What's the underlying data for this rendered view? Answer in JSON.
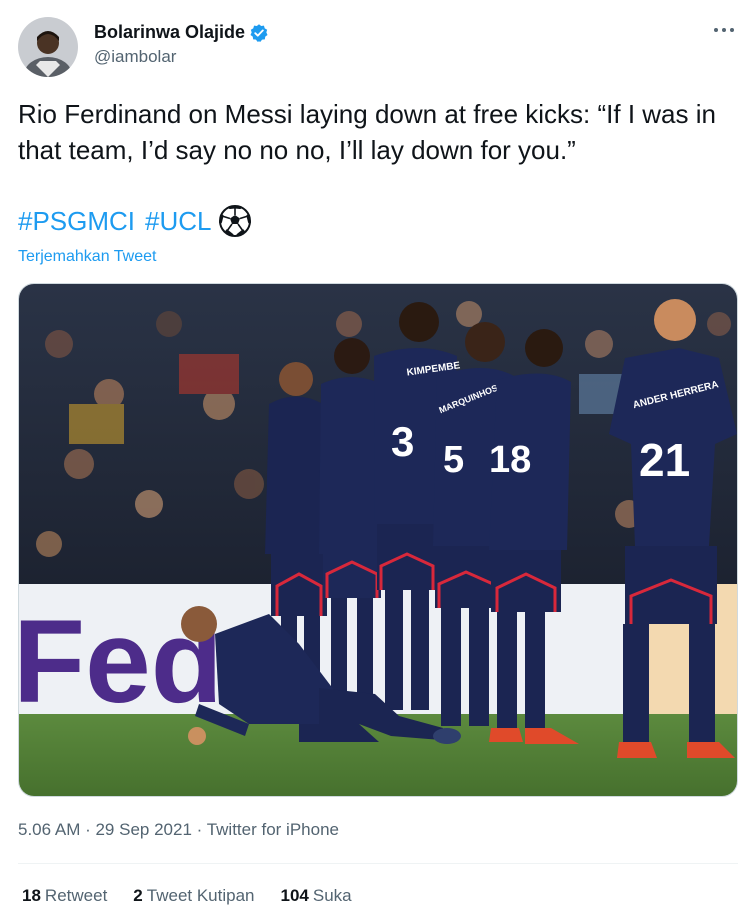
{
  "author": {
    "display_name": "Bolarinwa Olajide",
    "handle": "@iambolar",
    "verified_icon": "verified-badge-icon",
    "avatar": "avatar"
  },
  "tweet": {
    "text": "Rio Ferdinand on Messi laying down at free kicks: “If I was in that team, I’d say no no no, I’ll lay down for you.”",
    "hashtags": [
      "#PSGMCI",
      "#UCL"
    ],
    "emoji_icon": "soccer-ball-icon",
    "translate_label": "Terjemahkan Tweet"
  },
  "media": {
    "shirt_numbers": [
      "3",
      "5",
      "18",
      "21"
    ],
    "shirt_names": [
      "KIMPEMBE",
      "MARQUINHOS",
      "ANDER HERRERA"
    ],
    "board_text": "Fed"
  },
  "meta": {
    "time_date_source": "5.06 AM · 29 Sep 2021 · Twitter for iPhone"
  },
  "stats": {
    "retweets_count": "18",
    "retweets_label": "Retweet",
    "quotes_count": "2",
    "quotes_label": "Tweet Kutipan",
    "likes_count": "104",
    "likes_label": "Suka"
  },
  "colors": {
    "accent": "#1d9bf0",
    "text": "#0f1419",
    "secondary": "#536471",
    "kit_navy": "#1b2552",
    "kit_red": "#d8283b",
    "pitch": "#4f7a36"
  }
}
